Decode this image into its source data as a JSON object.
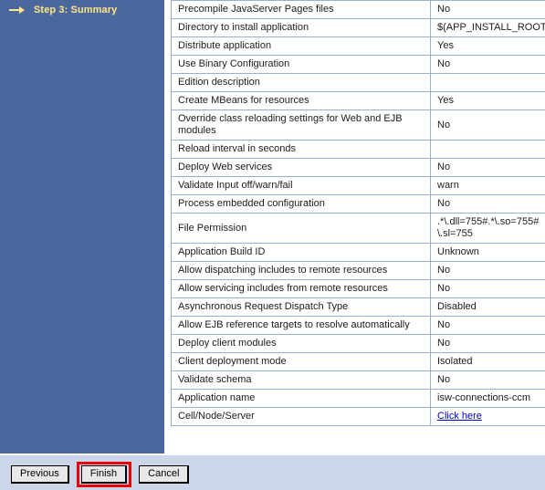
{
  "colors": {
    "panel_blue": "#4a689e",
    "step_text": "#ffe680",
    "table_border": "#9aafd4",
    "link": "#0000c8",
    "button_bar": "#ccd6e8",
    "highlight": "#ee0000"
  },
  "wizard": {
    "arrow_icon": "arrow-right-icon",
    "step_label": "Step 3: Summary"
  },
  "summary_table": {
    "rows": [
      {
        "label": "Precompile JavaServer Pages files",
        "value": "No"
      },
      {
        "label": "Directory to install application",
        "value": "$(APP_INSTALL_ROOT)/("
      },
      {
        "label": "Distribute application",
        "value": "Yes"
      },
      {
        "label": "Use Binary Configuration",
        "value": "No"
      },
      {
        "label": "Edition description",
        "value": ""
      },
      {
        "label": "Create MBeans for resources",
        "value": "Yes"
      },
      {
        "label": "Override class reloading settings for Web and EJB modules",
        "value": "No"
      },
      {
        "label": "Reload interval in seconds",
        "value": ""
      },
      {
        "label": "Deploy Web services",
        "value": "No"
      },
      {
        "label": "Validate Input off/warn/fail",
        "value": "warn"
      },
      {
        "label": "Process embedded configuration",
        "value": "No"
      },
      {
        "label": "File Permission",
        "value": ".*\\.dll=755#.*\\.so=755#\n\\.sl=755"
      },
      {
        "label": "Application Build ID",
        "value": "Unknown"
      },
      {
        "label": "Allow dispatching includes to remote resources",
        "value": "No"
      },
      {
        "label": "Allow servicing includes from remote resources",
        "value": "No"
      },
      {
        "label": "Asynchronous Request Dispatch Type",
        "value": "Disabled"
      },
      {
        "label": "Allow EJB reference targets to resolve automatically",
        "value": "No"
      },
      {
        "label": "Deploy client modules",
        "value": "No"
      },
      {
        "label": "Client deployment mode",
        "value": "Isolated"
      },
      {
        "label": "Validate schema",
        "value": "No"
      },
      {
        "label": "Application name",
        "value": "isw-connections-ccm"
      },
      {
        "label": "Cell/Node/Server",
        "value": "Click here",
        "is_link": true
      }
    ]
  },
  "buttons": {
    "previous": "Previous",
    "finish": "Finish",
    "cancel": "Cancel",
    "highlighted": "finish"
  }
}
